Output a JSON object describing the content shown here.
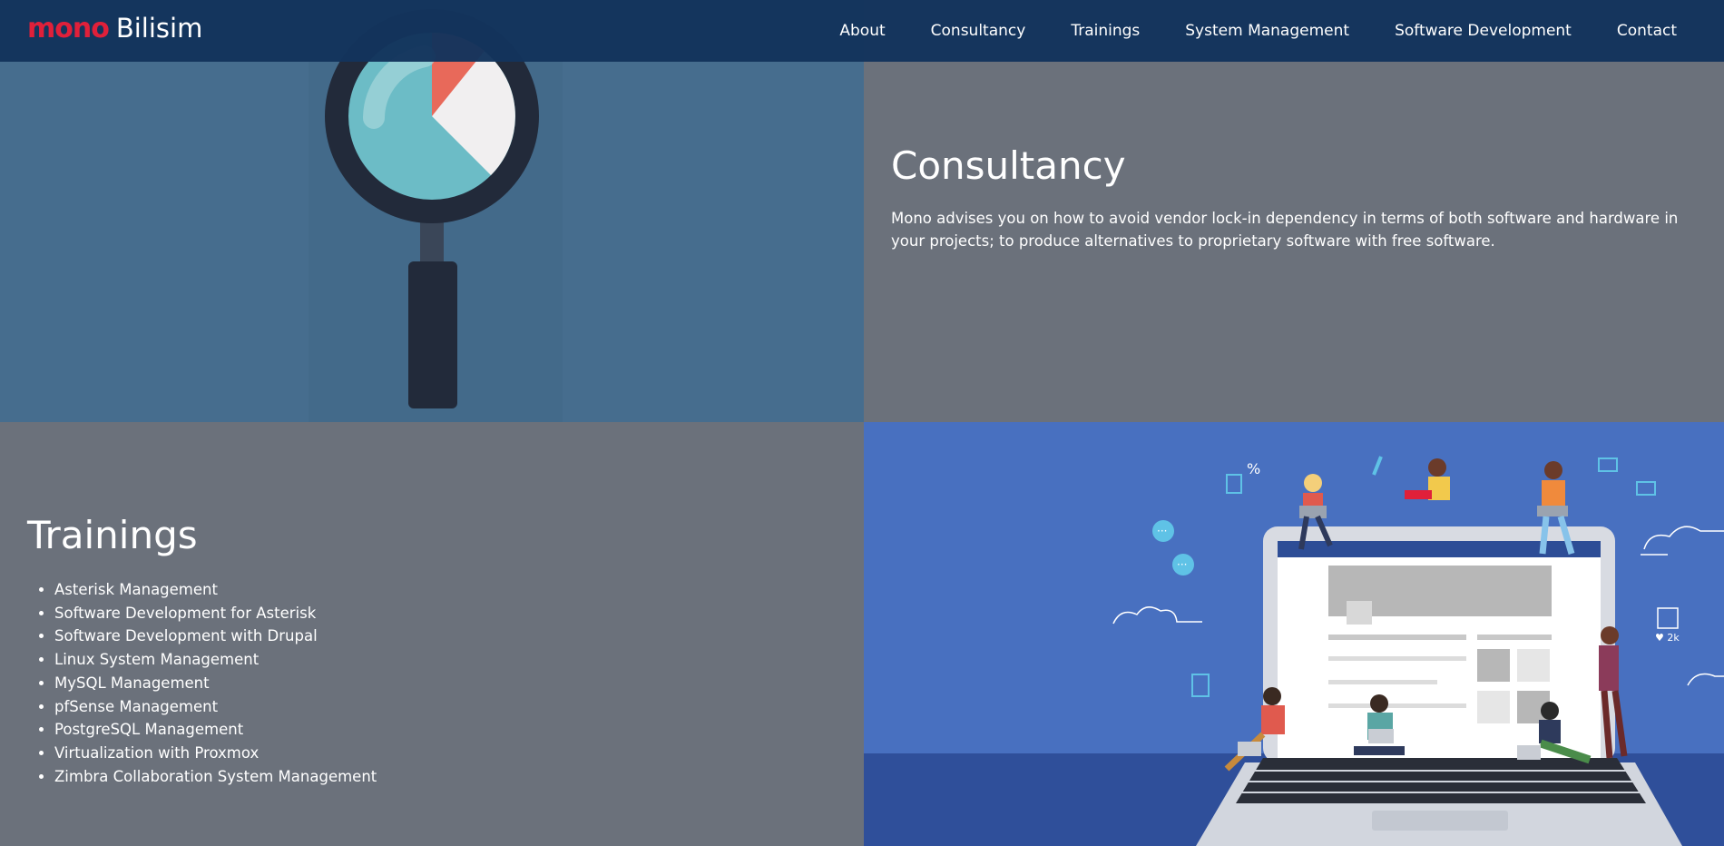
{
  "brand": {
    "logo_word": "mono",
    "name": "Bilisim"
  },
  "nav": {
    "items": [
      {
        "label": "About"
      },
      {
        "label": "Consultancy"
      },
      {
        "label": "Trainings"
      },
      {
        "label": "System Management"
      },
      {
        "label": "Software Development"
      },
      {
        "label": "Contact"
      }
    ]
  },
  "consultancy": {
    "title": "Consultancy",
    "description": "Mono advises you on how to avoid vendor lock-in dependency in terms of both software and hardware in your projects; to produce alternatives to proprietary software with free software.",
    "illustration_icon": "magnifier-pie-chart-icon"
  },
  "trainings": {
    "title": "Trainings",
    "items": [
      "Asterisk Management",
      "Software Development for Asterisk",
      "Software Development with Drupal",
      "Linux System Management",
      "MySQL Management",
      "pfSense Management",
      "PostgreSQL Management",
      "Virtualization with Proxmox",
      "Zimbra Collaboration System Management"
    ],
    "illustration_icon": "people-on-laptop-icon",
    "illustration_badges": {
      "discount": "%",
      "likes": "♥ 2k"
    }
  },
  "colors": {
    "navbar": "#13345c",
    "brand_accent": "#e0203a",
    "panel_gray": "#6b717b",
    "panel_steel_blue": "#466d8e",
    "panel_blue": "#4870c0"
  }
}
